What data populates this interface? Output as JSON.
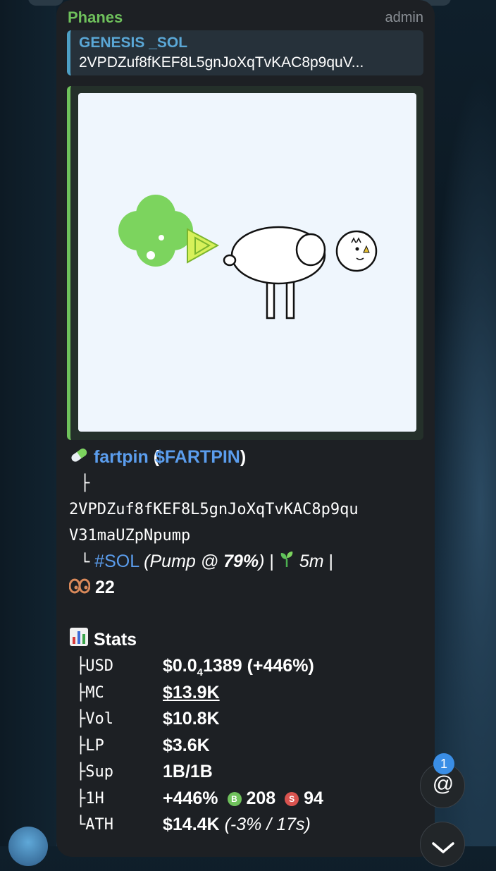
{
  "message": {
    "sender": "Phanes",
    "role": "admin",
    "reply": {
      "title": "GENESIS _SOL",
      "text": "2VPDZuf8fKEF8L5gnJoXqTvKAC8p9quV..."
    },
    "token": {
      "name": "fartpin",
      "ticker": "($FARTPIN)",
      "ticker_open": "(",
      "ticker_link": "$FARTPIN",
      "ticker_close": ")",
      "tree_branch": "├",
      "address_line1": "2VPDZuf8fKEF8L5gnJoXqTvKAC8p9qu",
      "address_line2": "V31maUZpNpump",
      "tree_end": "└",
      "chain": "#SOL",
      "pump_prefix": "(Pump @ ",
      "pump_pct": "79%",
      "pump_suffix": ")",
      "separator": "|",
      "age": "5m",
      "separator2": "|",
      "views": "22"
    },
    "stats": {
      "title": "Stats",
      "rows": [
        {
          "prefix": "├",
          "key": "USD",
          "value_main": "$0.0",
          "value_sub": "4",
          "value_rest": "1389 (+446%)"
        },
        {
          "prefix": "├",
          "key": "MC",
          "value": "$13.9K"
        },
        {
          "prefix": "├",
          "key": "Vol",
          "value": "$10.8K"
        },
        {
          "prefix": "├",
          "key": "LP",
          "value": "$3.6K"
        },
        {
          "prefix": "├",
          "key": "Sup",
          "value": "1B/1B"
        },
        {
          "prefix": "├",
          "key": "1H",
          "value": "+446%",
          "buy_label": "B",
          "buys": "208",
          "sell_label": "S",
          "sells": "94"
        },
        {
          "prefix": "└",
          "key": "ATH",
          "value": "$14.4K",
          "value_extra": "(-3% / 17s)"
        }
      ]
    }
  },
  "mentions": {
    "count": "1",
    "symbol": "@"
  },
  "colors": {
    "sender": "#6fc15c",
    "link": "#5b9ded",
    "reply_accent": "#4e9fc4",
    "preview_accent": "#6fc15c",
    "buy": "#6fc15c",
    "sell": "#d9534f",
    "badge": "#3a8ee6"
  }
}
